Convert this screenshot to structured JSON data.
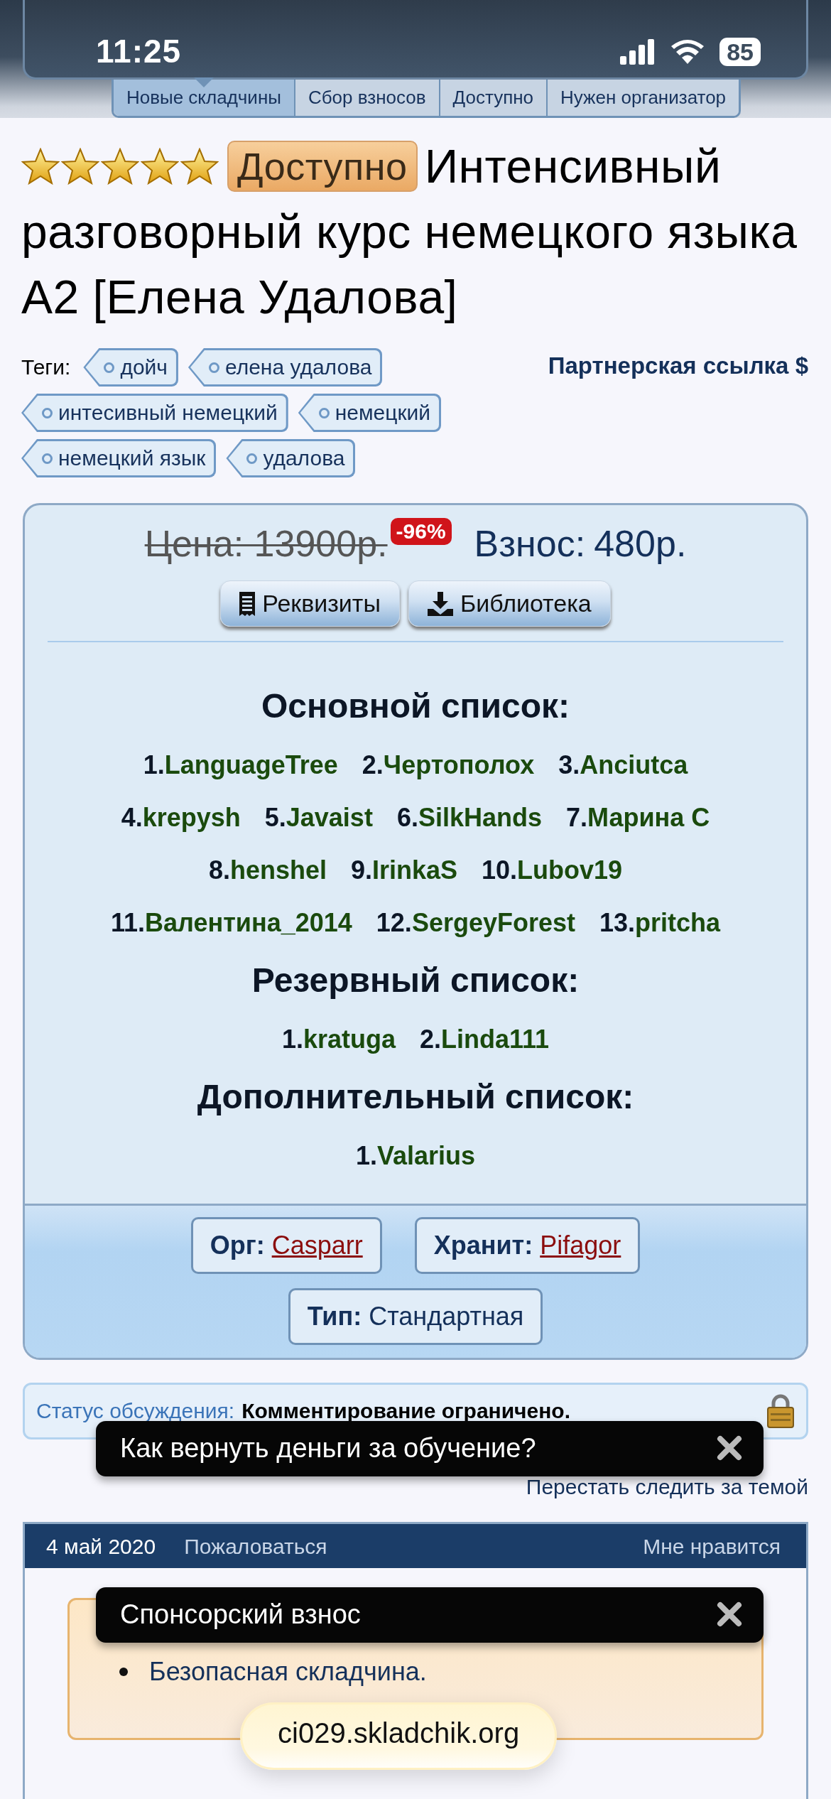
{
  "status_bar": {
    "time": "11:25",
    "battery": "85"
  },
  "nav_tabs": [
    {
      "label": "Новые складчины",
      "selected": true
    },
    {
      "label": "Сбор взносов",
      "selected": false
    },
    {
      "label": "Доступно",
      "selected": false
    },
    {
      "label": "Нужен организатор",
      "selected": false
    }
  ],
  "thread": {
    "stars": 5,
    "prefix": "Доступно",
    "title": "Интенсивный разговорный курс немецкого языка A2 [Елена Удалова]"
  },
  "tags_label": "Теги:",
  "tags": [
    "дойч",
    "елена удалова",
    "интесивный немецкий",
    "немецкий",
    "немецкий язык",
    "удалова"
  ],
  "partner_link": "Партнерская ссылка $",
  "price": {
    "old": "Цена: 13900р.",
    "discount": "-96%",
    "contribution_label": "Взнос:",
    "contribution": "480р."
  },
  "buttons": [
    {
      "label": "Реквизиты",
      "kind": "receipt"
    },
    {
      "label": "Библиотека",
      "kind": "download"
    }
  ],
  "lists": [
    {
      "title": "Основной список:",
      "members": [
        {
          "number": "1.",
          "name": "LanguageTree"
        },
        {
          "number": "2.",
          "name": "Чертополох"
        },
        {
          "number": "3.",
          "name": "Anciutca"
        },
        {
          "number": "4.",
          "name": "krepysh"
        },
        {
          "number": "5.",
          "name": "Javaist"
        },
        {
          "number": "6.",
          "name": "SilkHands"
        },
        {
          "number": "7.",
          "name": "Марина С"
        },
        {
          "number": "8.",
          "name": "henshel"
        },
        {
          "number": "9.",
          "name": "IrinkaS"
        },
        {
          "number": "10.",
          "name": "Lubov19"
        },
        {
          "number": "11.",
          "name": "Валентина_2014"
        },
        {
          "number": "12.",
          "name": "SergeyForest"
        },
        {
          "number": "13.",
          "name": "pritcha"
        }
      ]
    },
    {
      "title": "Резервный список:",
      "members": [
        {
          "number": "1.",
          "name": "kratuga"
        },
        {
          "number": "2.",
          "name": "Linda111"
        }
      ]
    },
    {
      "title": "Дополнительный список:",
      "members": [
        {
          "number": "1.",
          "name": "Valarius"
        }
      ]
    }
  ],
  "meta": [
    {
      "label": "Орг:",
      "value": "Casparr",
      "kind": "link"
    },
    {
      "label": "Хранит:",
      "value": "Pifagor",
      "kind": "link"
    },
    {
      "label": "Тип:",
      "value": "Стандартная",
      "kind": "text"
    }
  ],
  "discussion_status": {
    "label": "Статус обсуждения:",
    "value": "Комментирование ограничено."
  },
  "unwatch_link": "Перестать следить за темой",
  "post": {
    "date": "4 май 2020",
    "report": "Пожаловаться",
    "like": "Мне нравится",
    "bullets": [
      "Безопасная складчина."
    ]
  },
  "toasts": [
    {
      "text": "Как вернуть деньги за обучение?"
    },
    {
      "text": "Спонсорский взнос"
    }
  ],
  "url": "ci029.skladchik.org"
}
